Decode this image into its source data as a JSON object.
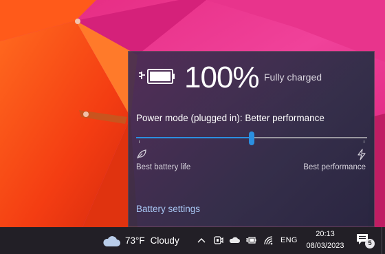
{
  "flyout": {
    "battery_percent_text": "100%",
    "status_text": "Fully charged",
    "power_mode_label": "Power mode (plugged in): Better performance",
    "slider": {
      "value": 0.5,
      "min_label": "Best battery life",
      "max_label": "Best performance"
    },
    "settings_link": "Battery settings",
    "icons": {
      "battery": "battery-charging-icon",
      "leaf": "leaf-icon",
      "bolt": "lightning-icon"
    }
  },
  "taskbar": {
    "weather": {
      "temperature": "73°F",
      "condition": "Cloudy",
      "icon": "cloud-icon"
    },
    "tray_icons": [
      "chevron-up-icon",
      "teams-meet-icon",
      "onedrive-icon",
      "battery-icon",
      "wifi-icon"
    ],
    "language": "ENG",
    "time": "20:13",
    "date": "08/03/2023",
    "notification_count": "5"
  },
  "colors": {
    "accent": "#2b8fe0",
    "link": "#a9c8f5",
    "taskbar": "#221f26"
  }
}
